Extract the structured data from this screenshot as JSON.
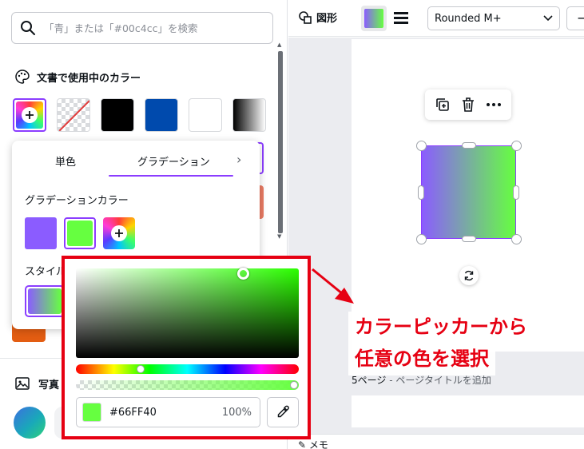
{
  "search": {
    "placeholder": "「青」または「#00c4cc」を検索"
  },
  "doc_colors": {
    "heading": "文書で使用中のカラー",
    "swatches": [
      "#000000",
      "#004aad",
      "#ffffff"
    ]
  },
  "gradient_panel": {
    "tabs": [
      {
        "label": "単色"
      },
      {
        "label": "グラデーション"
      }
    ],
    "stops_heading": "グラデーションカラー",
    "stops": [
      "#8b5cff",
      "#66ff40"
    ],
    "style_heading": "スタイル"
  },
  "photos": {
    "heading": "写真"
  },
  "toolbar": {
    "shapes_label": "図形",
    "font_name": "Rounded M+",
    "minus_label": "−"
  },
  "canvas": {
    "page_caption_number": "5ページ",
    "page_caption_hint": " - ページタイトルを追加",
    "notes_label": "メモ"
  },
  "picker": {
    "hex": "#66FF40",
    "opacity": "100%",
    "hue_position": 0.29,
    "saturation": 0.75,
    "value": 1.0,
    "alpha": 1.0
  },
  "annotation": {
    "lines": [
      "カラーピッカーから",
      "任意の色を選択"
    ],
    "color": "#e60012"
  },
  "colors": {
    "accent": "#8b3dff",
    "selected_color": "#66ff40"
  }
}
